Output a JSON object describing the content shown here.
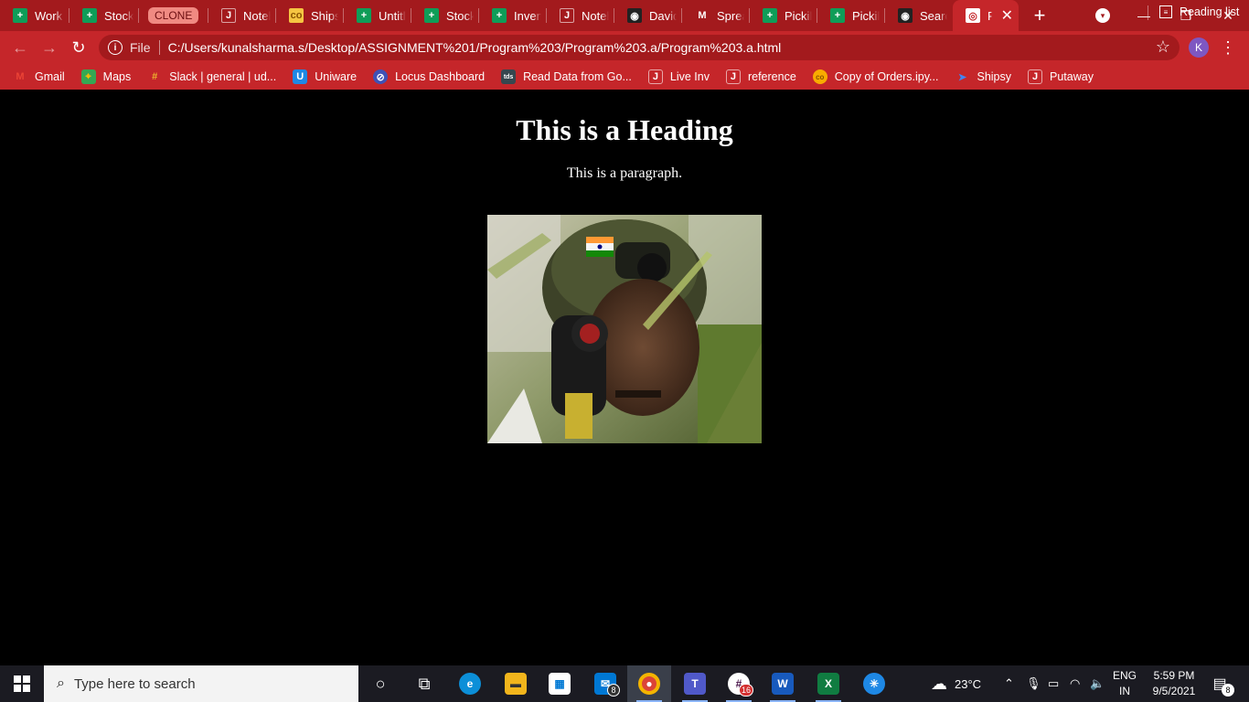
{
  "browser": {
    "tabs": [
      {
        "label": "Work (",
        "icon": "sheets-icon"
      },
      {
        "label": "Stockc",
        "icon": "sheets-icon"
      },
      {
        "label": "CLONE",
        "icon": "none"
      },
      {
        "label": "Noteb",
        "icon": "jupyter-icon"
      },
      {
        "label": "Shipsy",
        "icon": "shipsy-icon"
      },
      {
        "label": "Untitle",
        "icon": "sheets-icon"
      },
      {
        "label": "Stockc",
        "icon": "sheets-icon"
      },
      {
        "label": "Invent",
        "icon": "sheets-icon"
      },
      {
        "label": "Noteb",
        "icon": "jupyter-icon"
      },
      {
        "label": "David!",
        "icon": "github-icon"
      },
      {
        "label": "Spread",
        "icon": "gmail-icon"
      },
      {
        "label": "Pickily",
        "icon": "sheets-icon"
      },
      {
        "label": "Pickily",
        "icon": "sheets-icon"
      },
      {
        "label": "Search",
        "icon": "github-icon"
      },
      {
        "label": "Pr",
        "icon": "globe-icon"
      }
    ],
    "new_tab_label": "+",
    "address": {
      "security_label": "File",
      "url": "C:/Users/kunalsharma.s/Desktop/ASSIGNMENT%201/Program%203/Program%203.a/Program%203.a.html"
    },
    "profile_initial": "K",
    "bookmarks": [
      {
        "label": "Gmail",
        "icon": "gmail-icon"
      },
      {
        "label": "Maps",
        "icon": "maps-icon"
      },
      {
        "label": "Slack | general | ud...",
        "icon": "slack-icon"
      },
      {
        "label": "Uniware",
        "icon": "uniware-icon"
      },
      {
        "label": "Locus Dashboard",
        "icon": "locus-icon"
      },
      {
        "label": "Read Data from Go...",
        "icon": "tds-icon"
      },
      {
        "label": "Live Inv",
        "icon": "jupyter-icon"
      },
      {
        "label": "reference",
        "icon": "jupyter-icon"
      },
      {
        "label": "Copy of Orders.ipy...",
        "icon": "colab-icon"
      },
      {
        "label": "Shipsy",
        "icon": "shipsy-arrow-icon"
      },
      {
        "label": "Putaway",
        "icon": "jupyter-icon"
      }
    ],
    "reading_list_label": "Reading list"
  },
  "page": {
    "heading": "This is a Heading",
    "paragraph": "This is a paragraph."
  },
  "taskbar": {
    "search_placeholder": "Type here to search",
    "apps": [
      {
        "name": "cortana"
      },
      {
        "name": "task-view"
      },
      {
        "name": "edge"
      },
      {
        "name": "file-explorer"
      },
      {
        "name": "microsoft-store"
      },
      {
        "name": "mail",
        "badge": "8"
      },
      {
        "name": "chrome"
      },
      {
        "name": "teams"
      },
      {
        "name": "slack",
        "badge": "16"
      },
      {
        "name": "word"
      },
      {
        "name": "excel"
      },
      {
        "name": "app-circle"
      }
    ],
    "weather": {
      "temp": "23°C"
    },
    "language": {
      "line1": "ENG",
      "line2": "IN"
    },
    "clock": {
      "time": "5:59 PM",
      "date": "9/5/2021"
    },
    "notifications_count": "8"
  }
}
